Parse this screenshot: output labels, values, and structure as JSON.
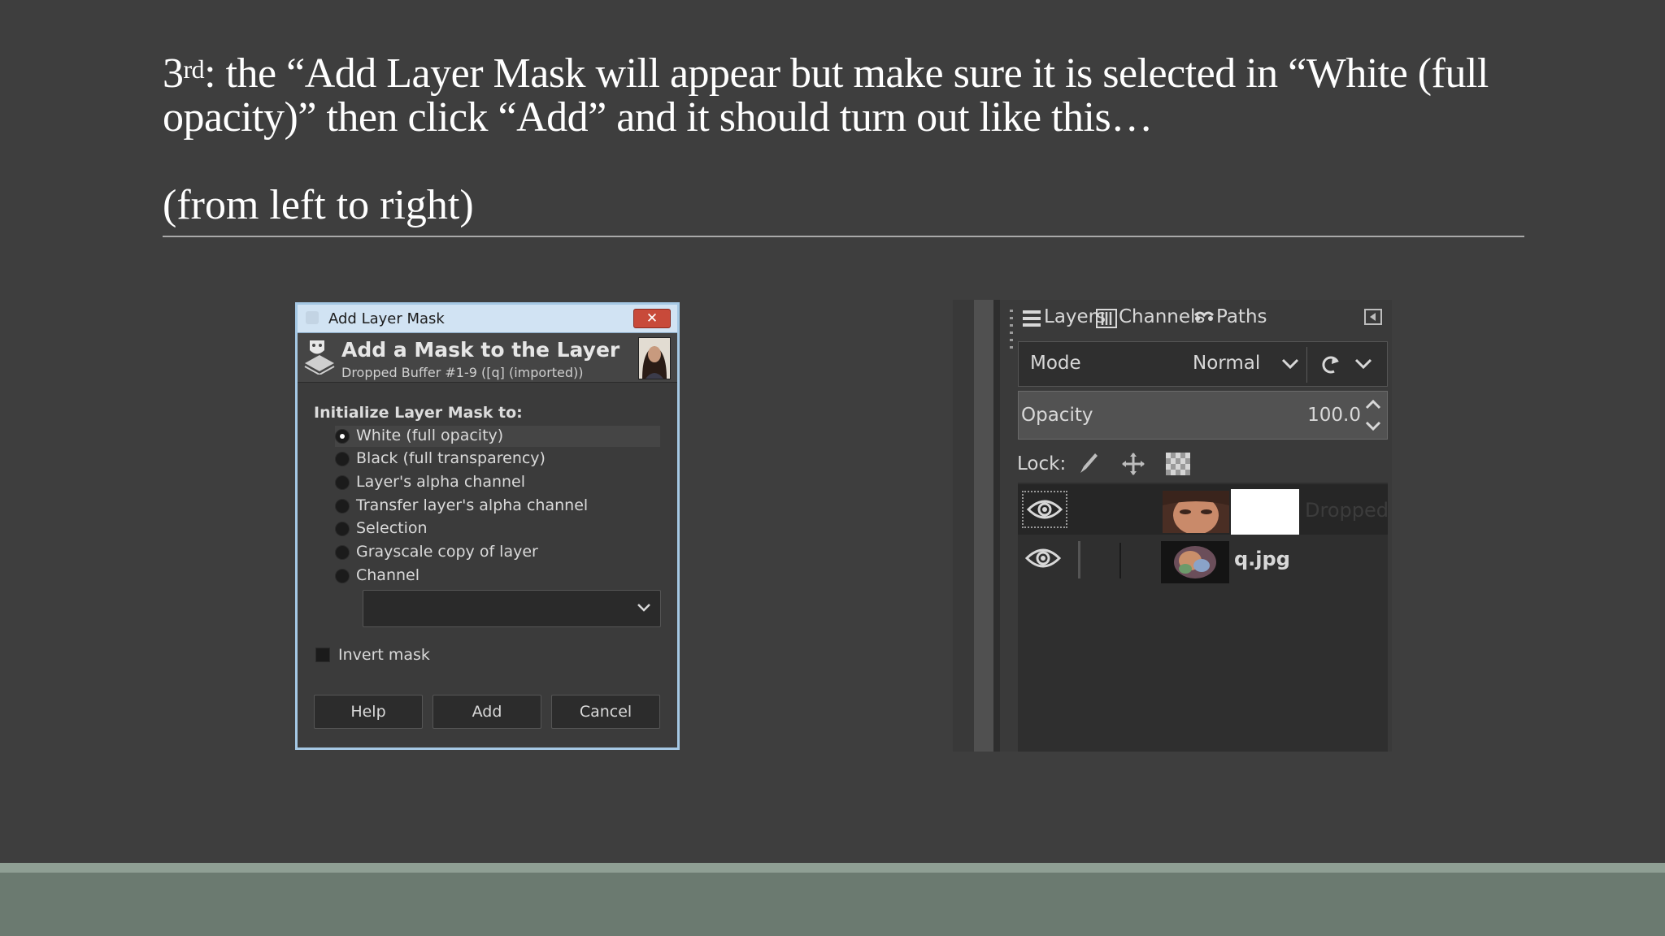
{
  "slide": {
    "title_prefix": "3",
    "title_sup": "rd",
    "title_line1": ": the “Add Layer Mask will appear but make sure it is selected in “White (full",
    "title_line2": "opacity)” then click “Add” and it should turn out like this…",
    "subtitle": "(from left to right)"
  },
  "dialog": {
    "window_title": "Add Layer Mask",
    "close_glyph": "✕",
    "header_title": "Add a Mask to the Layer",
    "header_subtitle": "Dropped Buffer #1-9 ([q] (imported))",
    "section_label": "Initialize Layer Mask to:",
    "options": [
      {
        "label": "White (full opacity)",
        "selected": true
      },
      {
        "label": "Black (full transparency)",
        "selected": false
      },
      {
        "label": "Layer's alpha channel",
        "selected": false
      },
      {
        "label": "Transfer layer's alpha channel",
        "selected": false
      },
      {
        "label": "Selection",
        "selected": false
      },
      {
        "label": "Grayscale copy of layer",
        "selected": false
      },
      {
        "label": "Channel",
        "selected": false
      }
    ],
    "channel_select_value": "",
    "invert_label": "Invert mask",
    "invert_checked": false,
    "buttons": {
      "help": "Help",
      "add": "Add",
      "cancel": "Cancel"
    }
  },
  "layers_panel": {
    "tabs": [
      "Layers",
      "Channels",
      "Paths"
    ],
    "mode_label": "Mode",
    "mode_value": "Normal",
    "opacity_label": "Opacity",
    "opacity_value": "100.0",
    "lock_label": "Lock:",
    "layers": [
      {
        "name": "Dropped",
        "visible": true,
        "has_mask": true,
        "active": true
      },
      {
        "name": "q.jpg",
        "visible": true,
        "has_mask": false,
        "active": false
      }
    ]
  },
  "colors": {
    "background": "#3e3e3e",
    "footer": "#6b7a70",
    "footer_line": "#8f9f94",
    "dialog_border": "#a5c8e4",
    "titlebar": "#d1e3f3",
    "close_button": "#c84a3a"
  }
}
